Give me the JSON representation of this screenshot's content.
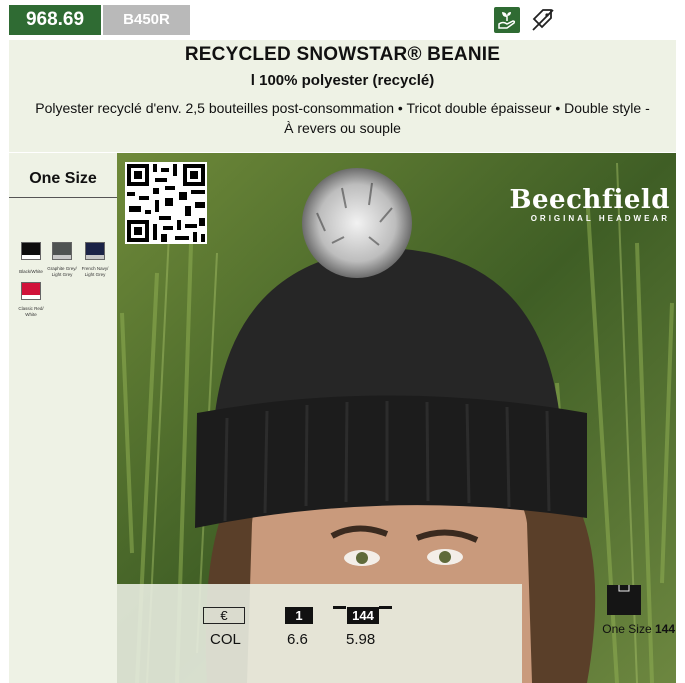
{
  "header": {
    "product_code": "968.69",
    "reference": "B450R",
    "icons": [
      "eco-recycled-icon",
      "no-tag-icon"
    ]
  },
  "product": {
    "title": "RECYCLED SNOWSTAR® BEANIE",
    "subtitle": "l 100% polyester (recyclé)",
    "description": "Polyester recyclé d'env. 2,5 bouteilles post-consommation • Tricot double épaisseur • Double style - À revers ou souple",
    "brand": "Beechfield",
    "brand_tagline": "ORIGINAL HEADWEAR"
  },
  "sizes": {
    "label": "One Size"
  },
  "colors": [
    {
      "name": "Black/White",
      "main": "#0d0d0d",
      "trim": "#ffffff"
    },
    {
      "name": "Graphite Grey/ Light Grey",
      "main": "#4f5352",
      "trim": "#c8c8c8"
    },
    {
      "name": "French Navy/ Light Grey",
      "main": "#1b2347",
      "trim": "#c8c8c8"
    },
    {
      "name": "Classic Red/ White",
      "main": "#d1123a",
      "trim": "#ffffff"
    }
  ],
  "pricing": {
    "currency": "€",
    "row_label": "COL",
    "tiers": [
      {
        "qty": "1",
        "price": "6.6"
      },
      {
        "qty": "144",
        "price": "5.98"
      }
    ]
  },
  "packaging": {
    "size_label": "One Size",
    "quantity": "144"
  },
  "theme": {
    "accent": "#2f6b33",
    "band": "#eef2e5",
    "ref_grey": "#b9b9b9"
  }
}
